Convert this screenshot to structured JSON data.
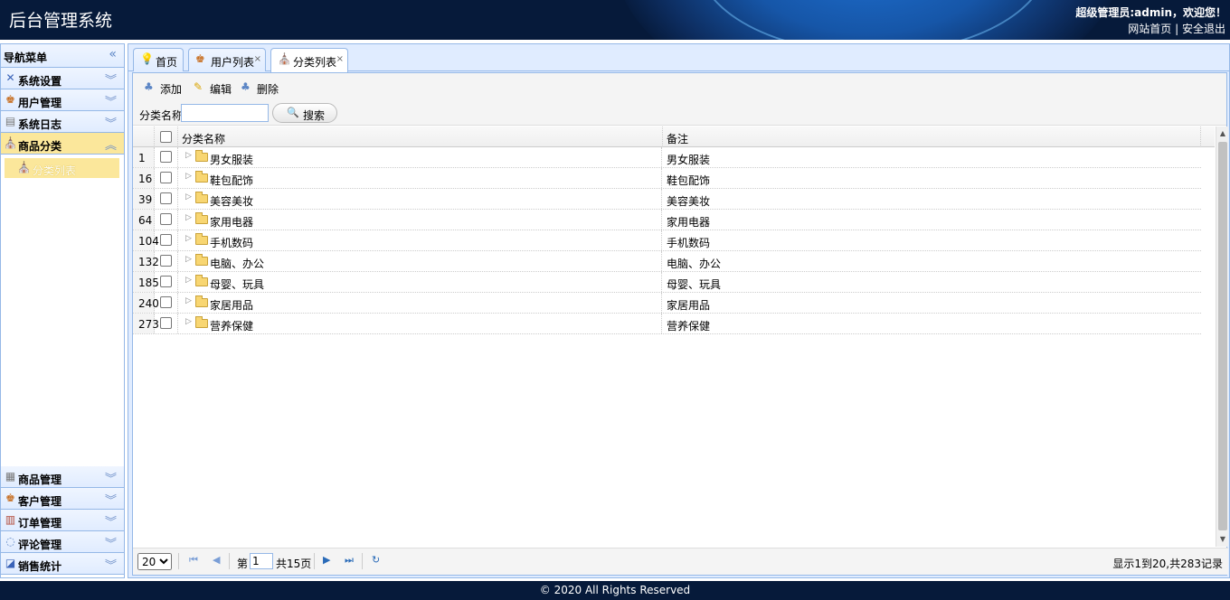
{
  "header": {
    "title": "后台管理系统",
    "user_text": "超级管理员:admin，欢迎您！",
    "link_home": "网站首页",
    "link_sep": "|",
    "link_logout": "安全退出"
  },
  "sidebar": {
    "title": "导航菜单",
    "collapse_icon": "«",
    "top_items": [
      {
        "label": "系统设置",
        "icon": "tools-icon"
      },
      {
        "label": "用户管理",
        "icon": "users-icon"
      },
      {
        "label": "系统日志",
        "icon": "log-icon"
      },
      {
        "label": "商品分类",
        "icon": "category-icon"
      }
    ],
    "active_sub_item": "分类列表",
    "bottom_items": [
      {
        "label": "商品管理",
        "icon": "product-icon"
      },
      {
        "label": "客户管理",
        "icon": "customer-icon"
      },
      {
        "label": "订单管理",
        "icon": "order-icon"
      },
      {
        "label": "评论管理",
        "icon": "comment-icon"
      },
      {
        "label": "销售统计",
        "icon": "stats-icon"
      }
    ]
  },
  "tabs": [
    {
      "label": "首页",
      "icon": "lightbulb-icon",
      "closable": false
    },
    {
      "label": "用户列表",
      "icon": "users-icon",
      "closable": true
    },
    {
      "label": "分类列表",
      "icon": "category-icon",
      "closable": true,
      "active": true
    }
  ],
  "tab_close": "×",
  "toolbar": {
    "add": "添加",
    "edit": "编辑",
    "delete": "删除",
    "search_label": "分类名称:",
    "search_value": "",
    "search_button": "搜索"
  },
  "table": {
    "columns": [
      "分类名称",
      "备注"
    ],
    "rows": [
      {
        "id": "1",
        "name": "男女服装",
        "note": "男女服装"
      },
      {
        "id": "16",
        "name": "鞋包配饰",
        "note": "鞋包配饰"
      },
      {
        "id": "39",
        "name": "美容美妆",
        "note": "美容美妆"
      },
      {
        "id": "64",
        "name": "家用电器",
        "note": "家用电器"
      },
      {
        "id": "104",
        "name": "手机数码",
        "note": "手机数码"
      },
      {
        "id": "132",
        "name": "电脑、办公",
        "note": "电脑、办公"
      },
      {
        "id": "185",
        "name": "母婴、玩具",
        "note": "母婴、玩具"
      },
      {
        "id": "240",
        "name": "家居用品",
        "note": "家居用品"
      },
      {
        "id": "273",
        "name": "营养保健",
        "note": "营养保健"
      }
    ]
  },
  "pager": {
    "page_size": "20",
    "page_prefix": "第",
    "page_value": "1",
    "page_suffix": "共15页",
    "info": "显示1到20,共283记录"
  },
  "footer": "© 2020 All Rights Reserved",
  "colors": {
    "header_bg": "#061a3a",
    "panel_border": "#95b8e7",
    "active_highlight": "#fbe79b"
  }
}
